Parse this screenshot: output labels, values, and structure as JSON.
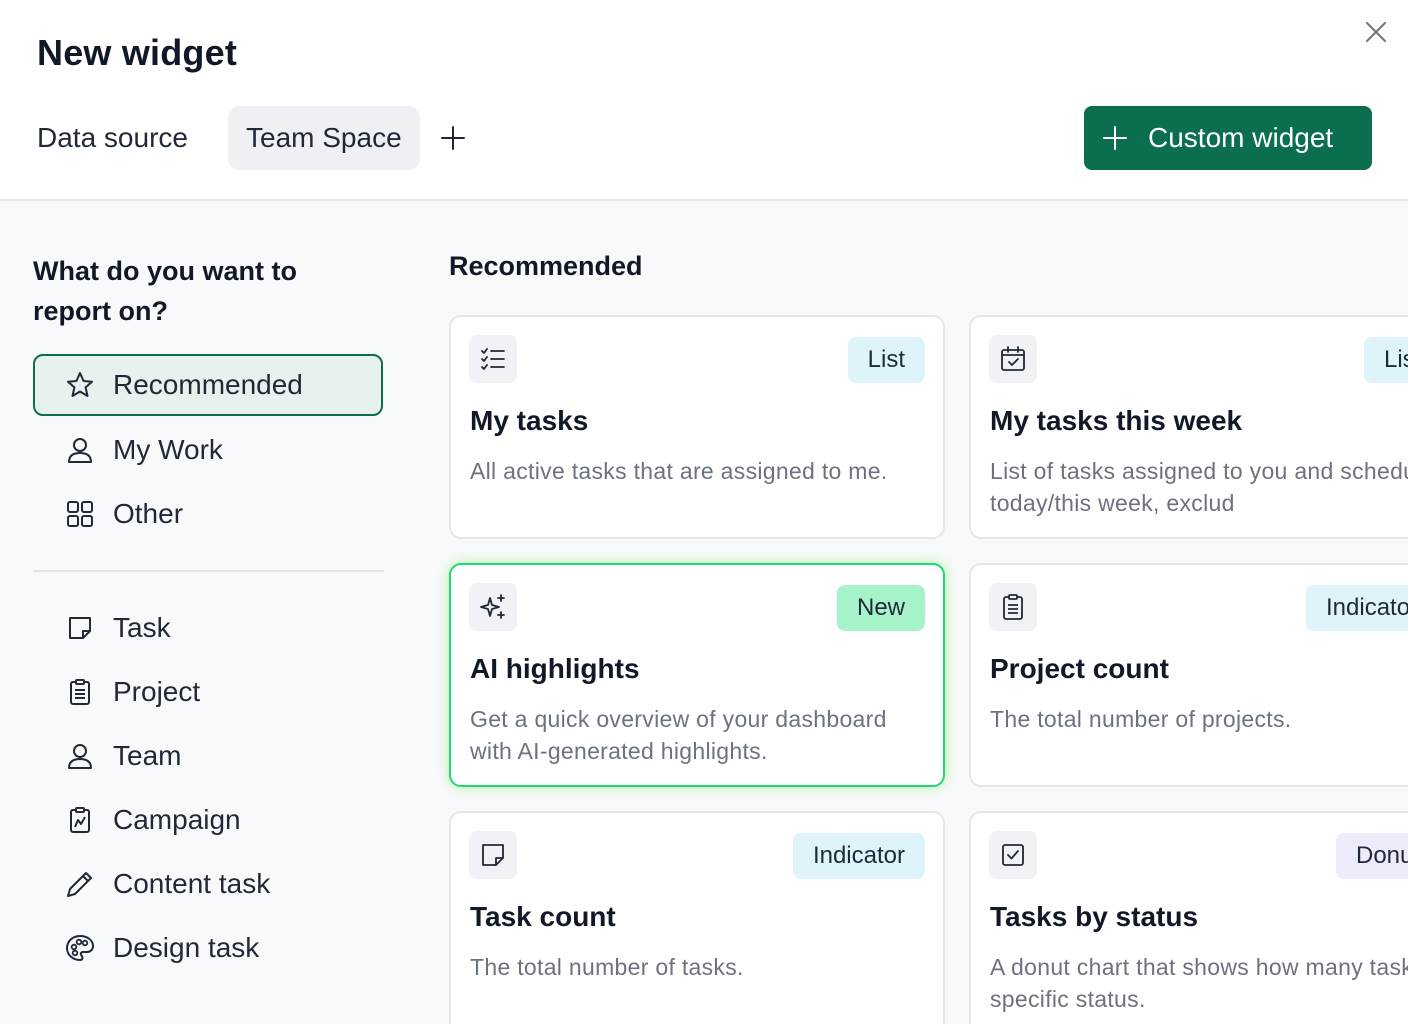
{
  "dialog": {
    "title": "New widget",
    "data_source_label": "Data source",
    "data_source_value": "Team Space",
    "custom_widget_label": "Custom widget"
  },
  "colors": {
    "accent": "#0b6e4f",
    "badge_list": "#dff3fa",
    "badge_new": "#a7f3c9",
    "badge_indicator": "#dff3fa",
    "badge_donut": "#eceafb",
    "highlight_border": "#22d67a"
  },
  "sidebar": {
    "question": "What do you want to report on?",
    "categories": [
      {
        "label": "Recommended",
        "icon": "star-icon",
        "active": true
      },
      {
        "label": "My Work",
        "icon": "person-icon",
        "active": false
      },
      {
        "label": "Other",
        "icon": "grid-icon",
        "active": false
      }
    ],
    "types": [
      {
        "label": "Task",
        "icon": "note-icon"
      },
      {
        "label": "Project",
        "icon": "clipboard-icon"
      },
      {
        "label": "Team",
        "icon": "person-icon"
      },
      {
        "label": "Campaign",
        "icon": "campaign-icon"
      },
      {
        "label": "Content task",
        "icon": "pencil-icon"
      },
      {
        "label": "Design task",
        "icon": "palette-icon"
      }
    ]
  },
  "main": {
    "section_title": "Recommended",
    "cards": [
      {
        "title": "My tasks",
        "description": "All active tasks that are assigned to me.",
        "badge": "List",
        "icon": "checklist-icon"
      },
      {
        "title": "My tasks this week",
        "description": "List of tasks assigned to you and scheduled for today/this week, exclud",
        "badge": "Lis",
        "icon": "calendar-check-icon"
      },
      {
        "title": "AI highlights",
        "description": "Get a quick overview of your dashboard with AI-generated highlights.",
        "badge": "New",
        "icon": "sparkle-icon"
      },
      {
        "title": "Project count",
        "description": "The total number of projects.",
        "badge": "Indicato",
        "icon": "clipboard-icon"
      },
      {
        "title": "Task count",
        "description": "The total number of tasks.",
        "badge": "Indicator",
        "icon": "note-icon"
      },
      {
        "title": "Tasks by status",
        "description": "A donut chart that shows how many tasks have a specific status.",
        "badge": "Donu",
        "icon": "checkbox-icon"
      }
    ]
  }
}
